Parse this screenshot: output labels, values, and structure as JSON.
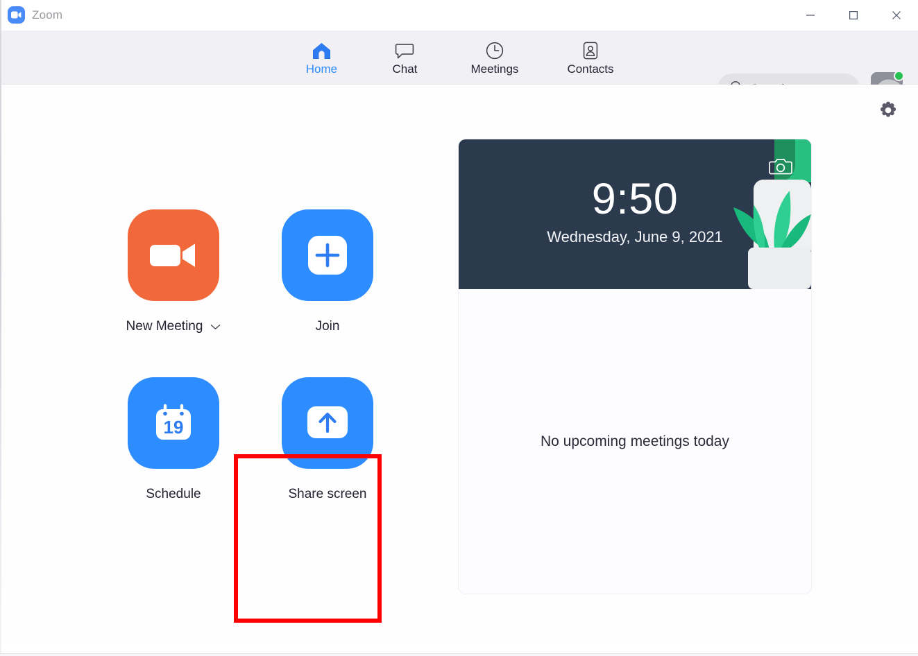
{
  "window": {
    "title": "Zoom",
    "logo_icon": "zoom-video-logo",
    "controls": {
      "minimize": "minimize-icon",
      "maximize": "maximize-icon",
      "close": "close-icon"
    }
  },
  "nav": {
    "tabs": [
      {
        "label": "Home",
        "icon": "home-icon",
        "active": true
      },
      {
        "label": "Chat",
        "icon": "chat-bubble-icon",
        "active": false
      },
      {
        "label": "Meetings",
        "icon": "clock-icon",
        "active": false
      },
      {
        "label": "Contacts",
        "icon": "contact-card-icon",
        "active": false
      }
    ],
    "search": {
      "placeholder": "Search",
      "value": "",
      "icon": "search-icon"
    },
    "avatar": {
      "name": "avatar",
      "image": "dog-profile-photo",
      "status": "available",
      "status_color": "#25c151"
    }
  },
  "content": {
    "settings_icon": "gear-icon",
    "actions": [
      {
        "label": "New Meeting",
        "icon": "video-camera-icon",
        "color": "#f1683a",
        "has_dropdown": true
      },
      {
        "label": "Join",
        "icon": "plus-square-icon",
        "color": "#2d8cff",
        "has_dropdown": false
      },
      {
        "label": "Schedule",
        "icon": "calendar-19-icon",
        "color": "#2d8cff",
        "has_dropdown": false,
        "calendar_day": "19"
      },
      {
        "label": "Share screen",
        "icon": "up-arrow-square-icon",
        "color": "#2d8cff",
        "has_dropdown": false
      }
    ],
    "highlight": {
      "target": "Share screen",
      "color": "#fe0000"
    },
    "panel": {
      "clock": {
        "time": "9:50",
        "date": "Wednesday, June 9, 2021",
        "background_color": "#2b3a4d",
        "camera_icon": "camera-icon"
      },
      "empty_state": "No upcoming meetings today"
    }
  }
}
